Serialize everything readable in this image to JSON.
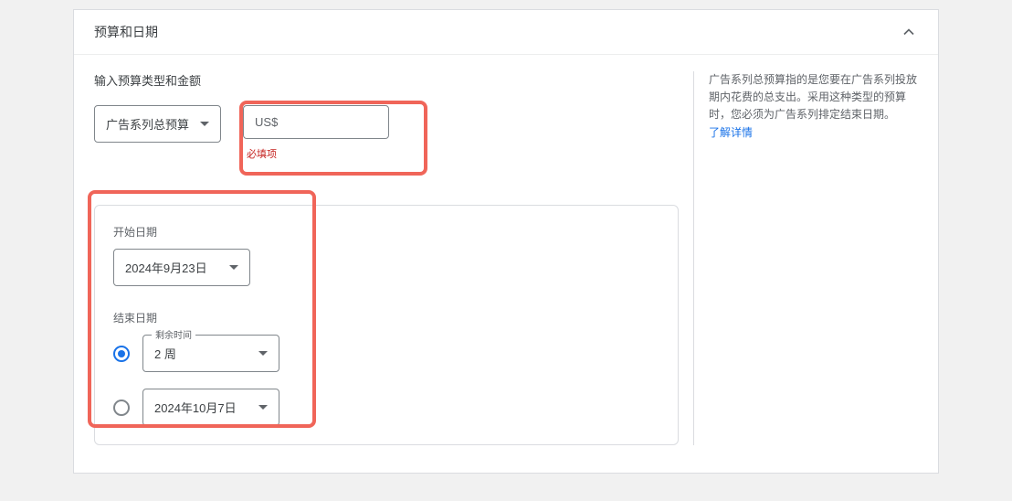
{
  "header": {
    "title": "预算和日期"
  },
  "budget": {
    "section_label": "输入预算类型和金额",
    "type_select_label": "广告系列总预算",
    "currency_prefix": "US$",
    "error_text": "必填项"
  },
  "dates": {
    "start_label": "开始日期",
    "start_date": "2024年9月23日",
    "end_label": "结束日期",
    "duration_legend": "剩余时间",
    "duration_value": "2 周",
    "end_date": "2024年10月7日"
  },
  "help": {
    "text": "广告系列总预算指的是您要在广告系列投放期内花费的总支出。采用这种类型的预算时，您必须为广告系列排定结束日期。",
    "link_label": "了解详情"
  }
}
